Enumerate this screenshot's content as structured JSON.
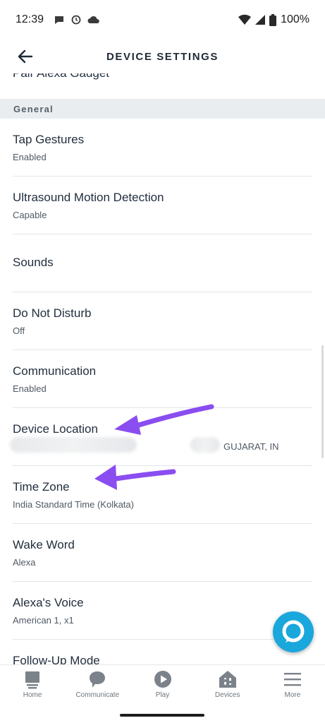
{
  "status_bar": {
    "time": "12:39",
    "battery": "100%",
    "icons": [
      "message-icon",
      "sync-icon",
      "cloud-icon",
      "wifi-icon",
      "signal-icon",
      "battery-icon"
    ]
  },
  "header": {
    "title": "DEVICE SETTINGS",
    "back_icon": "back-arrow-icon"
  },
  "clipped_item": "Pair Alexa Gadget",
  "section": {
    "label": "General"
  },
  "settings": [
    {
      "title": "Tap Gestures",
      "subtitle": "Enabled"
    },
    {
      "title": "Ultrasound Motion Detection",
      "subtitle": "Capable"
    },
    {
      "title": "Sounds",
      "subtitle": ""
    },
    {
      "title": "Do Not Disturb",
      "subtitle": "Off"
    },
    {
      "title": "Communication",
      "subtitle": "Enabled"
    },
    {
      "title": "Device Location",
      "subtitle": "GUJARAT, IN"
    },
    {
      "title": "Time Zone",
      "subtitle": "India Standard Time (Kolkata)"
    },
    {
      "title": "Wake Word",
      "subtitle": "Alexa"
    },
    {
      "title": "Alexa's Voice",
      "subtitle": "American 1, x1"
    },
    {
      "title": "Follow-Up Mode",
      "subtitle": ""
    }
  ],
  "fab": {
    "icon": "alexa-icon"
  },
  "bottom_nav": [
    {
      "label": "Home",
      "icon": "home-icon"
    },
    {
      "label": "Communicate",
      "icon": "chat-bubble-icon"
    },
    {
      "label": "Play",
      "icon": "play-icon"
    },
    {
      "label": "Devices",
      "icon": "devices-icon"
    },
    {
      "label": "More",
      "icon": "menu-icon"
    }
  ],
  "colors": {
    "accent": "#1aa7dc",
    "annotation_arrow": "#8a4df0",
    "section_bg": "#eaedef",
    "text_primary": "#232f3e"
  }
}
